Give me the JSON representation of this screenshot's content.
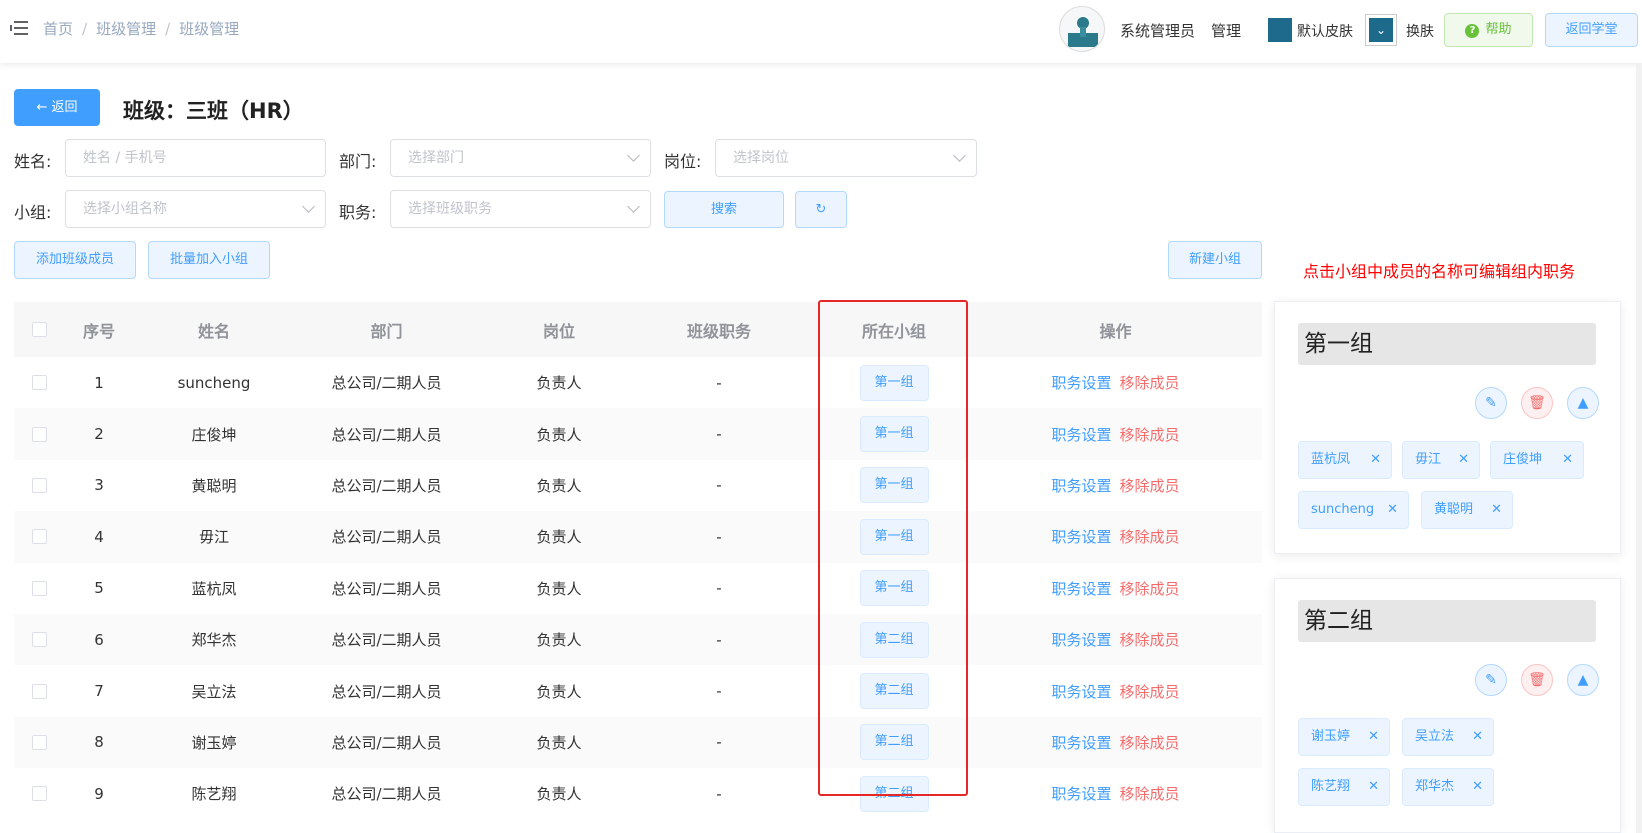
{
  "header": {
    "breadcrumb": [
      "首页",
      "班级管理",
      "班级管理"
    ],
    "user_name": "系统管理员",
    "user_role": "管理",
    "skin_label": "默认皮肤",
    "change_skin_label": "换肤",
    "help_label": "帮助",
    "return_label": "返回学堂",
    "skin_color": "#1d6a8a"
  },
  "page": {
    "back_label": "← 返回",
    "title": "班级：三班（HR）"
  },
  "filters": {
    "name_label": "姓名:",
    "name_placeholder": "姓名 / 手机号",
    "dept_label": "部门:",
    "dept_placeholder": "选择部门",
    "post_label": "岗位:",
    "post_placeholder": "选择岗位",
    "group_label": "小组:",
    "group_placeholder": "选择小组名称",
    "duty_label": "职务:",
    "duty_placeholder": "选择班级职务",
    "search_label": "搜索",
    "refresh_icon": "↻"
  },
  "actions": {
    "add_member": "添加班级成员",
    "batch_add_group": "批量加入小组",
    "new_group": "新建小组"
  },
  "hint": "点击小组中成员的名称可编辑组内职务",
  "table": {
    "headers": [
      "序号",
      "姓名",
      "部门",
      "岗位",
      "班级职务",
      "所在小组",
      "操作"
    ],
    "op_set_label": "职务设置",
    "op_remove_label": "移除成员",
    "rows": [
      {
        "no": "1",
        "name": "suncheng",
        "dept": "总公司/二期人员",
        "post": "负责人",
        "duty": "-",
        "group": "第一组"
      },
      {
        "no": "2",
        "name": "庄俊坤",
        "dept": "总公司/二期人员",
        "post": "负责人",
        "duty": "-",
        "group": "第一组"
      },
      {
        "no": "3",
        "name": "黄聪明",
        "dept": "总公司/二期人员",
        "post": "负责人",
        "duty": "-",
        "group": "第一组"
      },
      {
        "no": "4",
        "name": "毋江",
        "dept": "总公司/二期人员",
        "post": "负责人",
        "duty": "-",
        "group": "第一组"
      },
      {
        "no": "5",
        "name": "蓝杭凤",
        "dept": "总公司/二期人员",
        "post": "负责人",
        "duty": "-",
        "group": "第一组"
      },
      {
        "no": "6",
        "name": "郑华杰",
        "dept": "总公司/二期人员",
        "post": "负责人",
        "duty": "-",
        "group": "第二组"
      },
      {
        "no": "7",
        "name": "吴立法",
        "dept": "总公司/二期人员",
        "post": "负责人",
        "duty": "-",
        "group": "第二组"
      },
      {
        "no": "8",
        "name": "谢玉婷",
        "dept": "总公司/二期人员",
        "post": "负责人",
        "duty": "-",
        "group": "第二组"
      },
      {
        "no": "9",
        "name": "陈艺翔",
        "dept": "总公司/二期人员",
        "post": "负责人",
        "duty": "-",
        "group": "第二组"
      }
    ]
  },
  "groups": [
    {
      "name": "第一组",
      "members": [
        "蓝杭凤",
        "毋江",
        "庄俊坤",
        "suncheng",
        "黄聪明"
      ]
    },
    {
      "name": "第二组",
      "members": [
        "谢玉婷",
        "吴立法",
        "陈艺翔",
        "郑华杰"
      ]
    }
  ],
  "icons": {
    "edit": "edit-icon",
    "delete": "delete-icon",
    "collapse": "caret-up-icon"
  }
}
